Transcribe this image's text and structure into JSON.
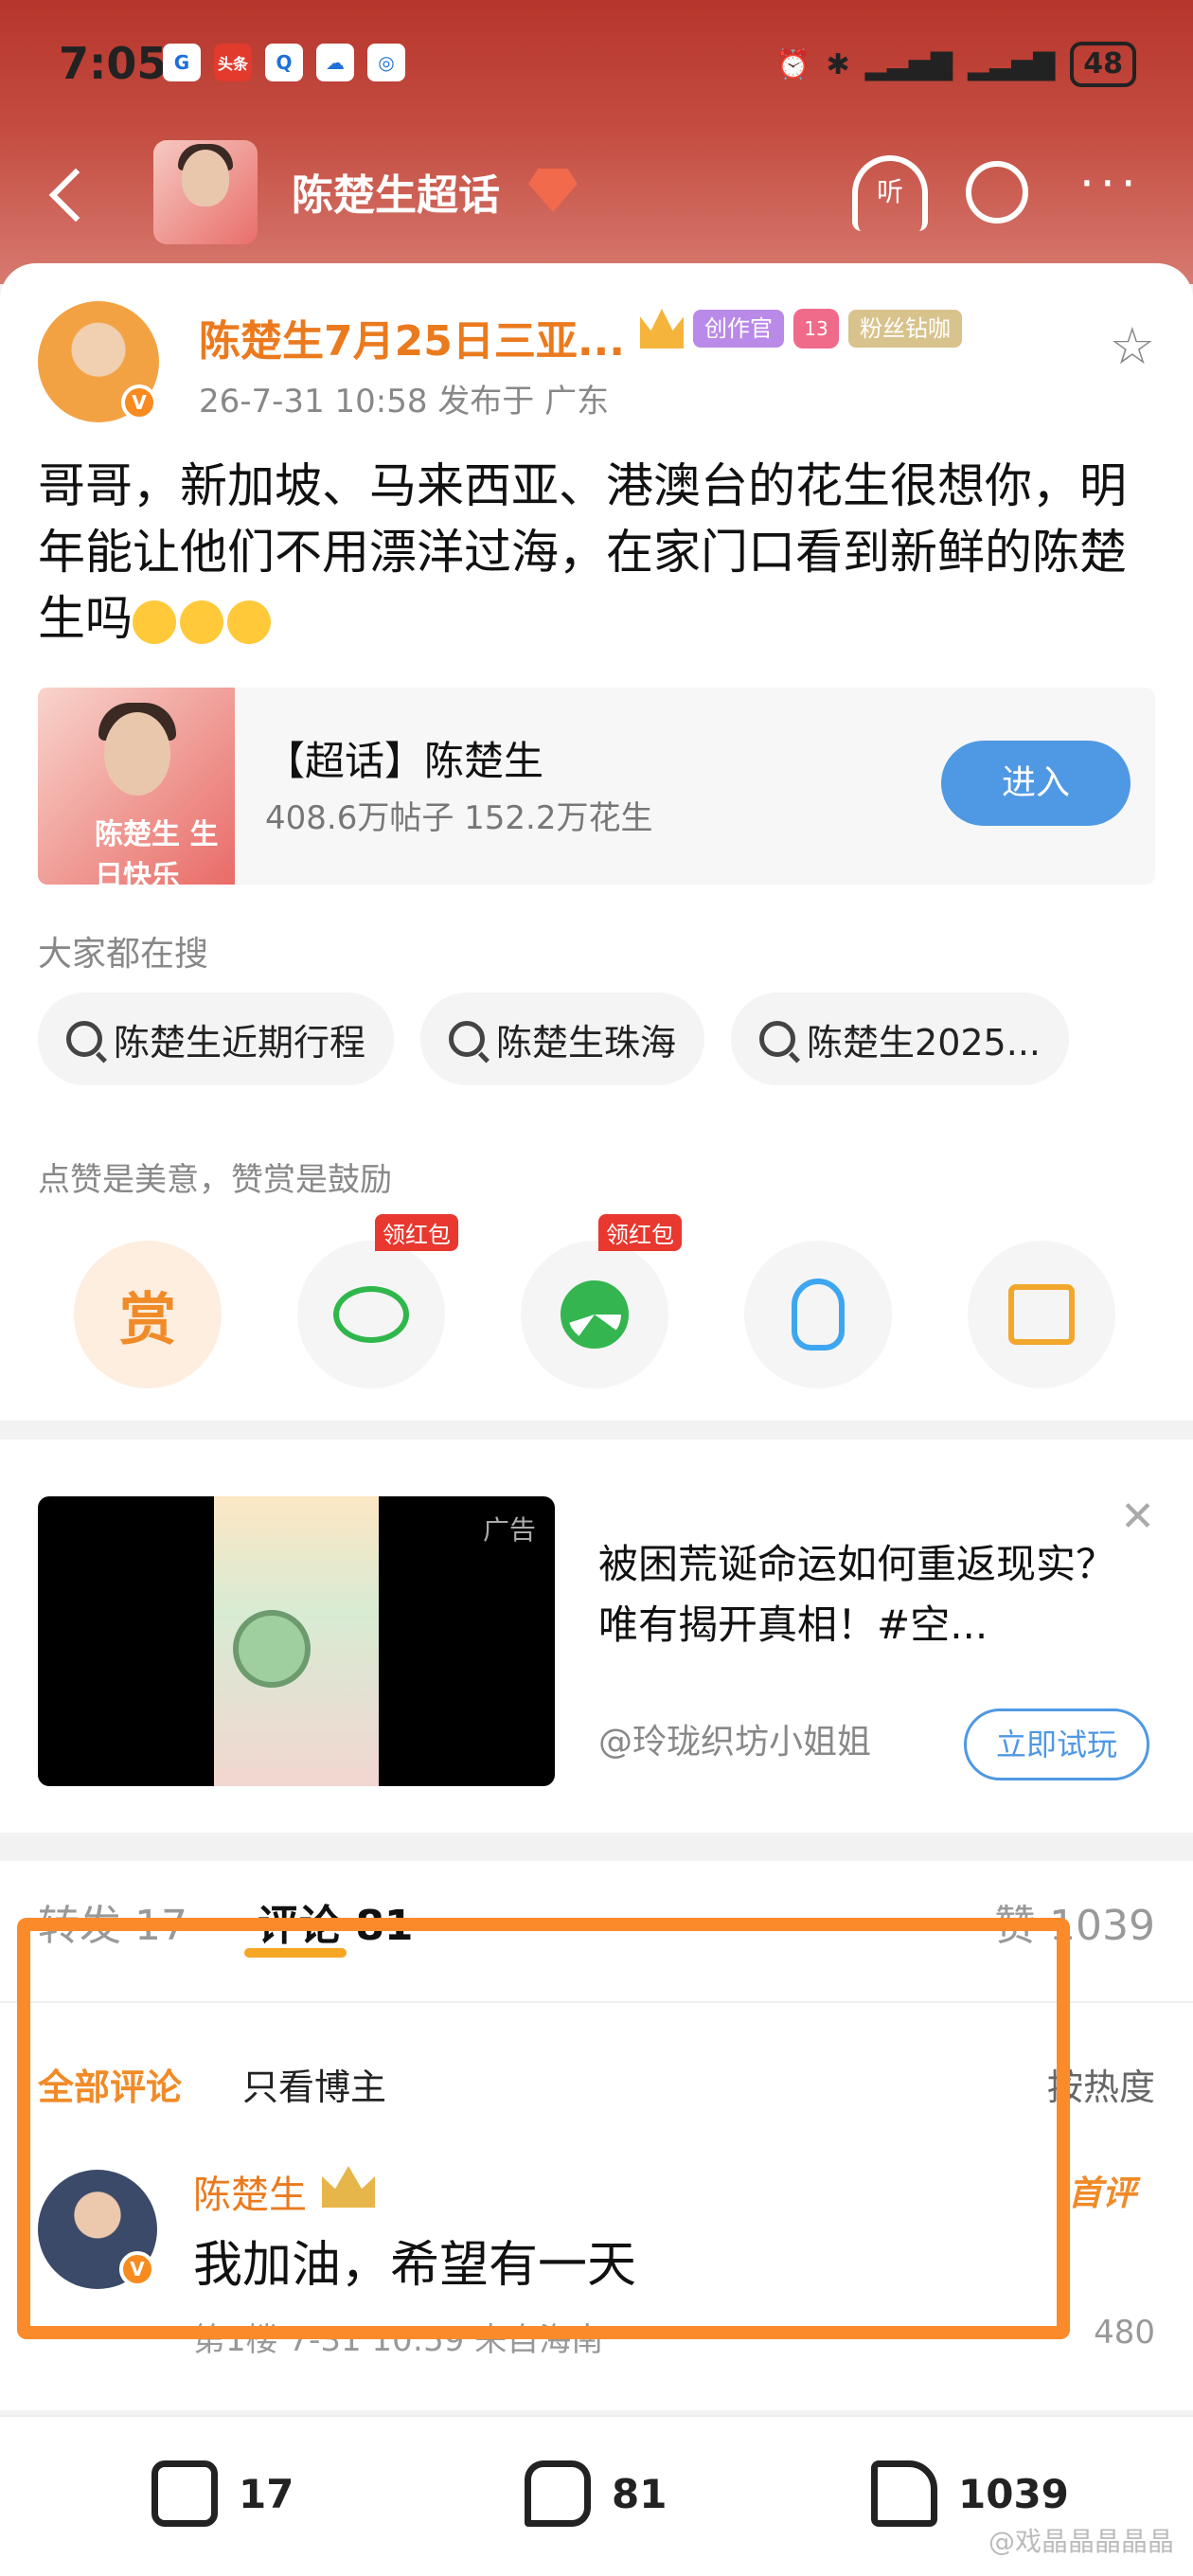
{
  "status": {
    "time": "7:05",
    "app_icons": [
      "G",
      "头条",
      "Q",
      "☁",
      "◎"
    ],
    "battery": "48"
  },
  "nav": {
    "title": "陈楚生超话",
    "level": "2",
    "listen_label": "听"
  },
  "post": {
    "author": "陈楚生7月25日三亚...",
    "badge_creator": "创作官",
    "badge_level": "13",
    "badge_fan": "粉丝钻咖",
    "meta": "26-7-31 10:58  发布于 广东",
    "text": "哥哥，新加坡、马来西亚、港澳台的花生很想你，明年能让他们不用漂洋过海，在家门口看到新鲜的陈楚生吗"
  },
  "super_topic": {
    "image_text": "陈楚生 生日快乐",
    "title": "【超话】陈楚生",
    "stats": "408.6万帖子 152.2万花生",
    "enter_label": "进入"
  },
  "search": {
    "label": "大家都在搜",
    "chips": [
      "陈楚生近期行程",
      "陈楚生珠海",
      "陈楚生2025..."
    ]
  },
  "reward": {
    "label": "点赞是美意，赞赏是鼓励",
    "shang": "赏",
    "red_packet_tag": "领红包"
  },
  "ad": {
    "label": "广告",
    "title": "被困荒诞命运如何重返现实？唯有揭开真相！#空...",
    "source": "@玲珑织坊小姐姐",
    "button": "立即试玩"
  },
  "comments": {
    "tab_repost": "转发 17",
    "tab_comment": "评论 81",
    "tab_like": "赞 1039",
    "filter_all": "全部评论",
    "filter_author": "只看博主",
    "sort": "按热度",
    "item": {
      "name": "陈楚生",
      "first_label": "首评",
      "text": "我加油，希望有一天",
      "meta": "第1楼 7-31 10:59 来自海南",
      "likes": "480"
    }
  },
  "bottom": {
    "repost": "17",
    "comment": "81",
    "like": "1039",
    "watermark": "@戏晶晶晶晶晶"
  }
}
